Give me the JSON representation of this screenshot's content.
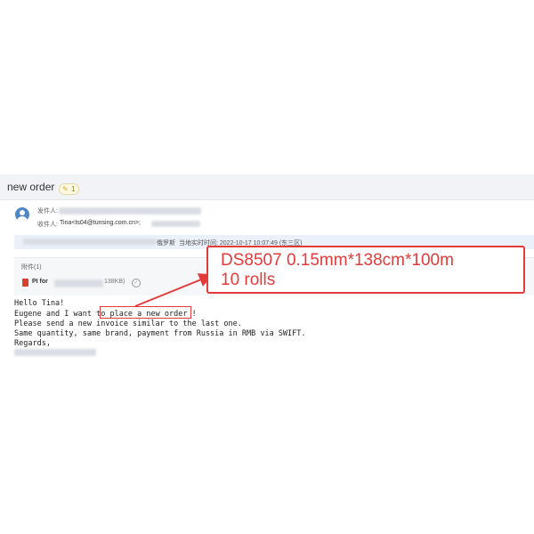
{
  "email": {
    "subject": "new order",
    "attachment_count_badge": "1",
    "sender_label": "发件人:",
    "recipient_label": "收件人:",
    "recipient_value": "Tina<ts04@tunsing.com.cn>;",
    "meta_location": "俄罗斯",
    "meta_time": "当地实时时间: 2022-10-17 10:07:49 (东三区)",
    "attachments_heading": "附件(1)",
    "attachment": {
      "name_prefix": "PI for",
      "size": "138KB)"
    },
    "body_lines": [
      "Hello Tina!",
      "Eugene and I want to place a new order !",
      "Please send a new invoice similar to the last one.",
      "Same quantity, same brand, payment from Russia in RMB via SWIFT.",
      "Regards,"
    ]
  },
  "annotation": {
    "line1": "DS8507 0.15mm*138cm*100m",
    "line2": "10 rolls",
    "color": "#e33a3a"
  },
  "icons": [
    "avatar-icon",
    "paperclip-icon",
    "pdf-icon",
    "check-circle-icon"
  ]
}
